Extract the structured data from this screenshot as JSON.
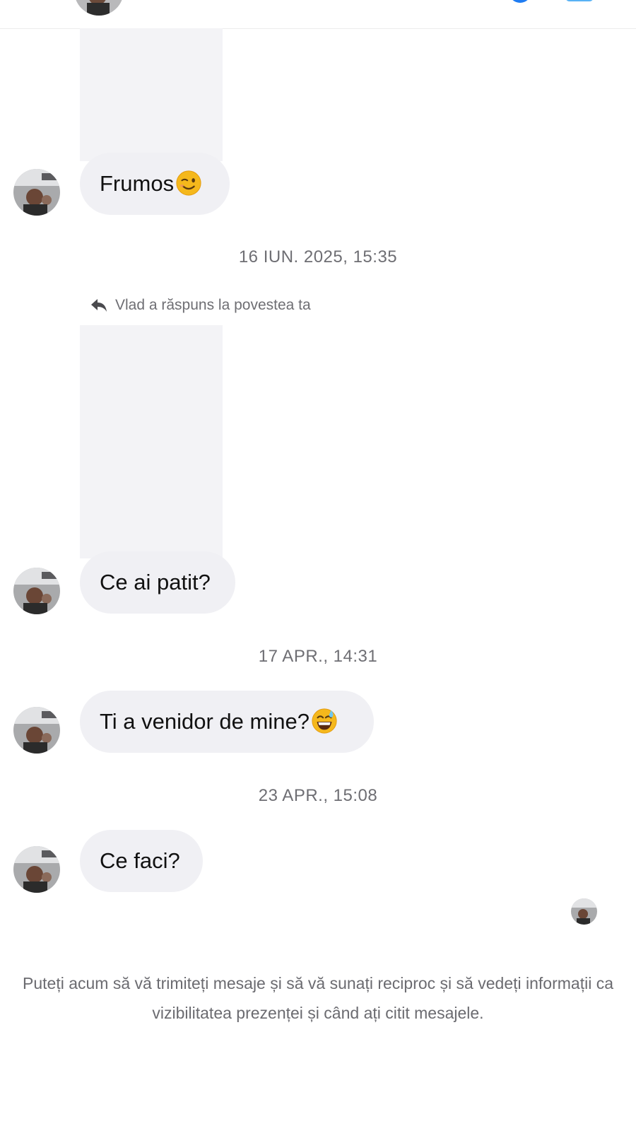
{
  "conversation": {
    "contact_name": "Vlad",
    "messages": [
      {
        "type": "story_reply",
        "text": "Frumos",
        "emoji": "winking-face"
      },
      {
        "type": "timestamp",
        "text": "16 IUN. 2025, 15:35"
      },
      {
        "type": "reply_notice",
        "text": "Vlad a răspuns la povestea ta"
      },
      {
        "type": "story_reply",
        "text": "Ce ai patit?"
      },
      {
        "type": "timestamp",
        "text": "17 APR., 14:31"
      },
      {
        "type": "message",
        "text": "Ti a venidor de mine?",
        "emoji": "grinning-face-with-sweat"
      },
      {
        "type": "timestamp",
        "text": "23 APR., 15:08"
      },
      {
        "type": "message",
        "text": "Ce faci?"
      }
    ],
    "footer_note": "Puteți acum să vă trimiteți mesaje și să vă sunați reciproc și să vedeți informații ca vizibilitatea prezenței și când ați citit mesajele."
  },
  "colors": {
    "bubble": "#f0f0f4",
    "story_placeholder": "#f3f3f6",
    "timestamp_text": "#6e6e73",
    "accent": "#1f7cf2"
  }
}
